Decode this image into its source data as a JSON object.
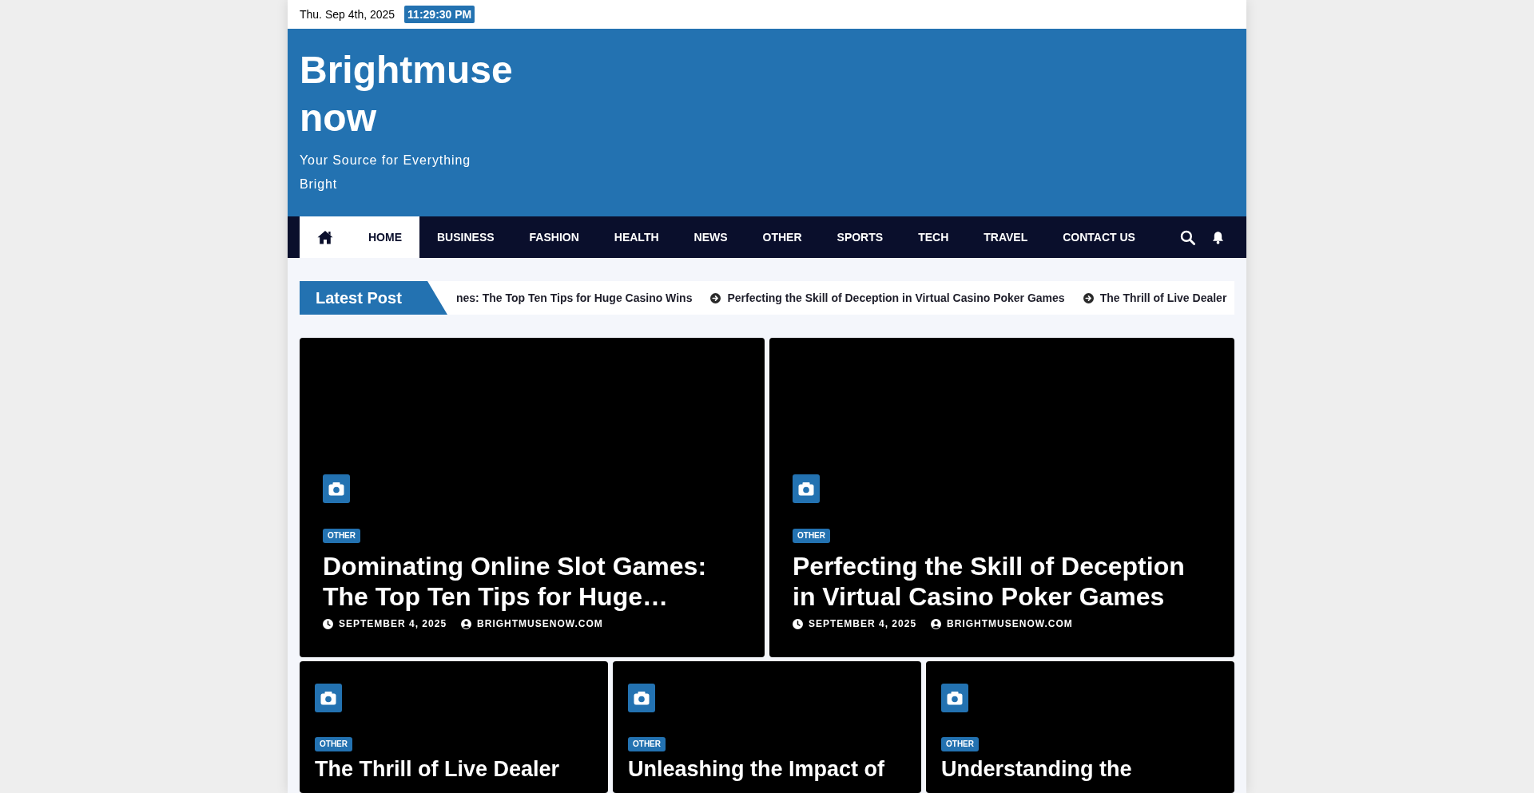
{
  "top_bar": {
    "date": "Thu. Sep 4th, 2025",
    "time": "11:29:30 PM"
  },
  "header": {
    "site_title": "Brightmuse now",
    "tagline": "Your Source for Everything Bright"
  },
  "nav": {
    "items": [
      {
        "label": "HOME",
        "selected": true
      },
      {
        "label": "BUSINESS",
        "selected": false
      },
      {
        "label": "FASHION",
        "selected": false
      },
      {
        "label": "HEALTH",
        "selected": false
      },
      {
        "label": "NEWS",
        "selected": false
      },
      {
        "label": "OTHER",
        "selected": false
      },
      {
        "label": "SPORTS",
        "selected": false
      },
      {
        "label": "TECH",
        "selected": false
      },
      {
        "label": "TRAVEL",
        "selected": false
      },
      {
        "label": "CONTACT US",
        "selected": false
      }
    ]
  },
  "ticker": {
    "label": "Latest Post",
    "items": [
      {
        "text": "nes: The Top Ten Tips for Huge Casino Wins",
        "arrow": false
      },
      {
        "text": "Perfecting the Skill of Deception in Virtual Casino Poker Games",
        "arrow": true
      },
      {
        "text": "The Thrill of Live Dealer",
        "arrow": true
      }
    ]
  },
  "featured_posts": [
    {
      "category": "OTHER",
      "title": "Dominating Online Slot Games: The Top Ten Tips for Huge…",
      "date": "SEPTEMBER 4, 2025",
      "author": "BRIGHTMUSENOW.COM"
    },
    {
      "category": "OTHER",
      "title": "Perfecting the Skill of Deception in Virtual Casino Poker Games",
      "date": "SEPTEMBER 4, 2025",
      "author": "BRIGHTMUSENOW.COM"
    }
  ],
  "posts": [
    {
      "category": "OTHER",
      "title": "The Thrill of Live Dealer"
    },
    {
      "category": "OTHER",
      "title": "Unleashing the Impact of"
    },
    {
      "category": "OTHER",
      "title": "Understanding the"
    }
  ]
}
